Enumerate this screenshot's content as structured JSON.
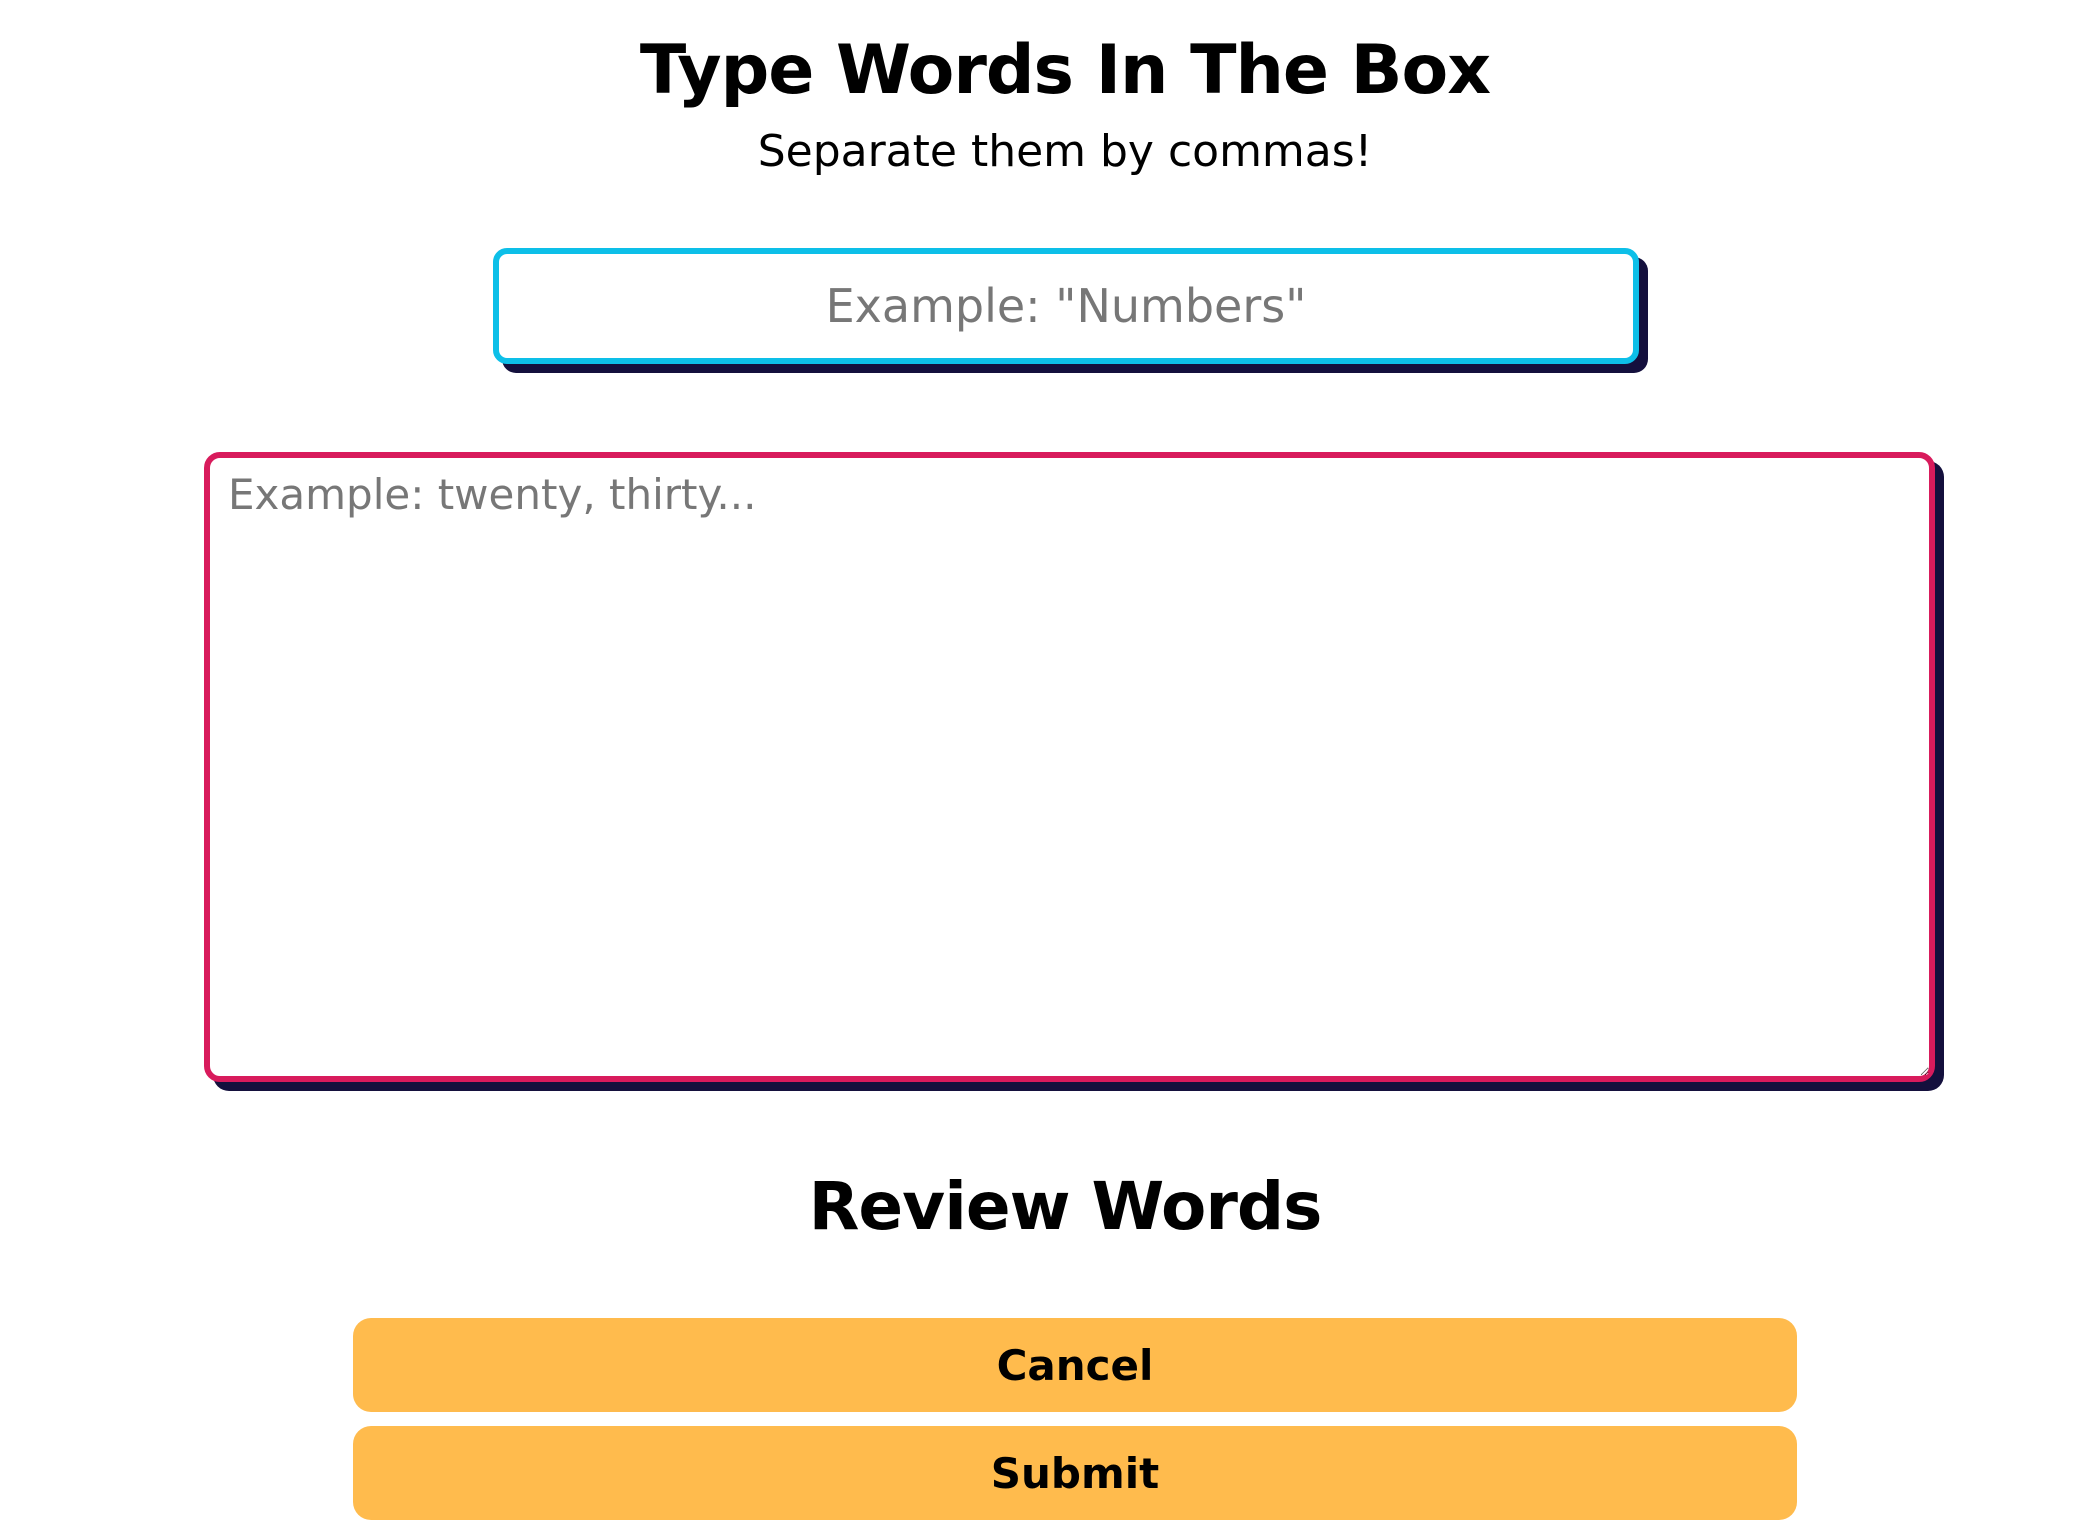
{
  "header": {
    "title": "Type Words In The Box",
    "subtitle": "Separate them by commas!"
  },
  "title_input": {
    "value": "",
    "placeholder": "Example: \"Numbers\""
  },
  "words_textarea": {
    "value": "",
    "placeholder": "Example: twenty, thirty..."
  },
  "review": {
    "heading": "Review Words"
  },
  "actions": {
    "cancel_label": "Cancel",
    "submit_label": "Submit"
  },
  "colors": {
    "title_input_border": "#0dbfe8",
    "textarea_border": "#d81b5c",
    "shadow": "#14103d",
    "button_bg": "#ffbb4d"
  }
}
